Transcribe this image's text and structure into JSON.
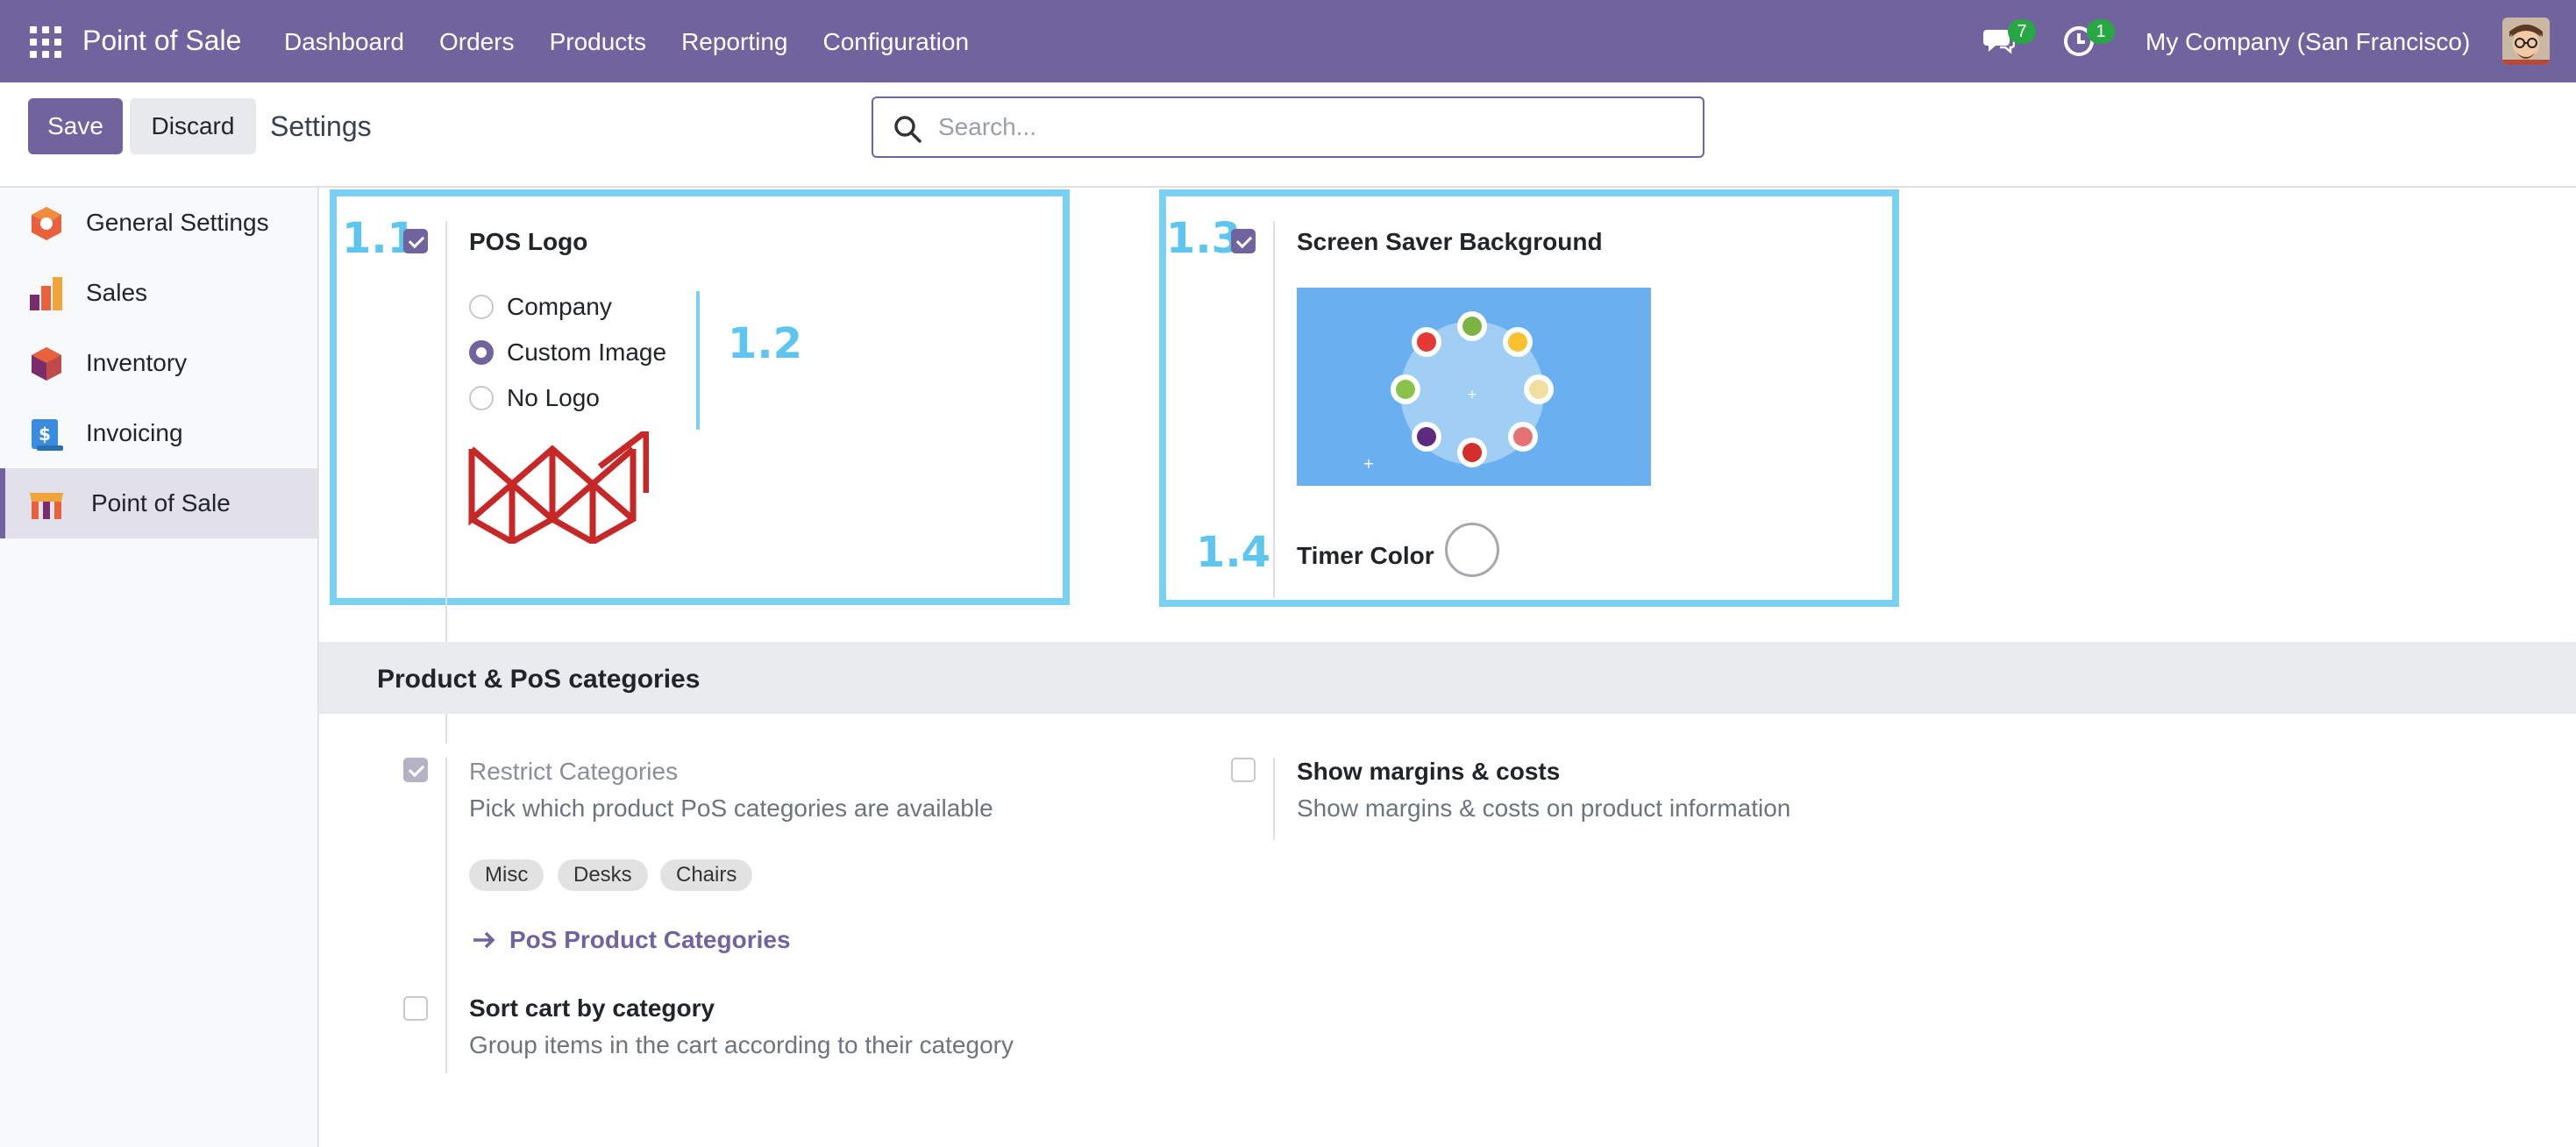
{
  "navbar": {
    "brand": "Point of Sale",
    "menu": [
      "Dashboard",
      "Orders",
      "Products",
      "Reporting",
      "Configuration"
    ],
    "chat_count": "7",
    "activity_count": "1",
    "company": "My Company (San Francisco)",
    "color": "#71639e"
  },
  "control": {
    "save_label": "Save",
    "discard_label": "Discard",
    "title": "Settings",
    "search_placeholder": "Search..."
  },
  "sidebar": {
    "items": [
      {
        "label": "General Settings",
        "icon": "general-settings-icon"
      },
      {
        "label": "Sales",
        "icon": "sales-icon"
      },
      {
        "label": "Inventory",
        "icon": "inventory-icon"
      },
      {
        "label": "Invoicing",
        "icon": "invoicing-icon"
      },
      {
        "label": "Point of Sale",
        "icon": "point-of-sale-icon",
        "active": true
      }
    ]
  },
  "annotations": {
    "a1": "1.1",
    "a2": "1.2",
    "a3": "1.3",
    "a4": "1.4",
    "color": "#79d0f0"
  },
  "pos_logo": {
    "title": "POS Logo",
    "checked": true,
    "options": [
      {
        "label": "Company",
        "selected": false
      },
      {
        "label": "Custom Image",
        "selected": true
      },
      {
        "label": "No Logo",
        "selected": false
      }
    ]
  },
  "screen_saver": {
    "title": "Screen Saver Background",
    "checked": true,
    "timer_label": "Timer Color"
  },
  "section": {
    "title": "Product & PoS categories"
  },
  "restrict_categories": {
    "title": "Restrict Categories",
    "desc": "Pick which product PoS categories are available",
    "checked": true,
    "tags": [
      "Misc",
      "Desks",
      "Chairs"
    ],
    "link": "PoS Product Categories"
  },
  "show_margins": {
    "title": "Show margins & costs",
    "desc": "Show margins & costs on product information",
    "checked": false
  },
  "sort_cart": {
    "title": "Sort cart by category",
    "desc": "Group items in the cart according to their category",
    "checked": false
  }
}
